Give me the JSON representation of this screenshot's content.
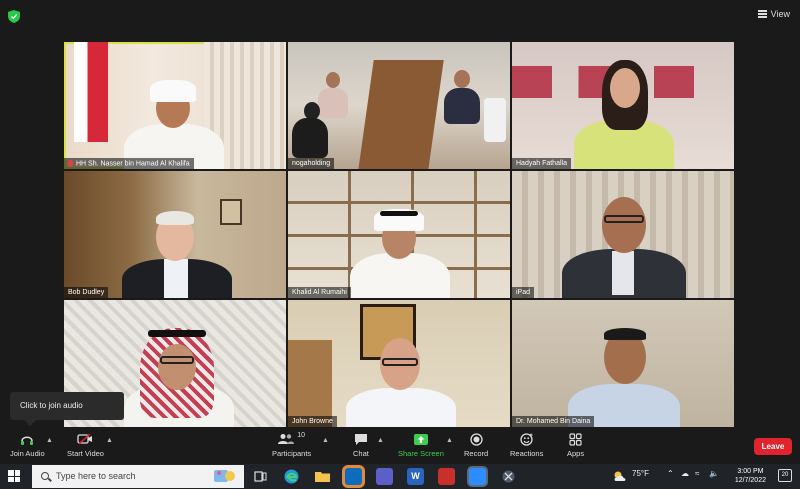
{
  "topbar": {
    "view_label": "View"
  },
  "participants": [
    {
      "name": "HH Sh. Nasser bin Hamad Al Khalifa"
    },
    {
      "name": "nogaholding"
    },
    {
      "name": "Hadyah Fathalla"
    },
    {
      "name": "Bob Dudley"
    },
    {
      "name": "Khalid Al Rumaihi"
    },
    {
      "name": "iPad"
    },
    {
      "name": ""
    },
    {
      "name": "John Browne"
    },
    {
      "name": "Dr. Mohamed Bin Daina"
    }
  ],
  "tooltip": {
    "text": "Click to join audio"
  },
  "toolbar": {
    "join_audio": "Join Audio",
    "start_video": "Start Video",
    "participants": "Participants",
    "participants_count": "10",
    "chat": "Chat",
    "share_screen": "Share Screen",
    "record": "Record",
    "reactions": "Reactions",
    "apps": "Apps",
    "leave": "Leave"
  },
  "taskbar": {
    "search_placeholder": "Type here to search",
    "temperature": "75°F",
    "time": "3:00 PM",
    "date": "12/7/2022",
    "notification_count": "20"
  },
  "colors": {
    "active_speaker_border": "#d8e04a",
    "leave_button": "#e0242e",
    "share_screen": "#3ccf4e"
  }
}
